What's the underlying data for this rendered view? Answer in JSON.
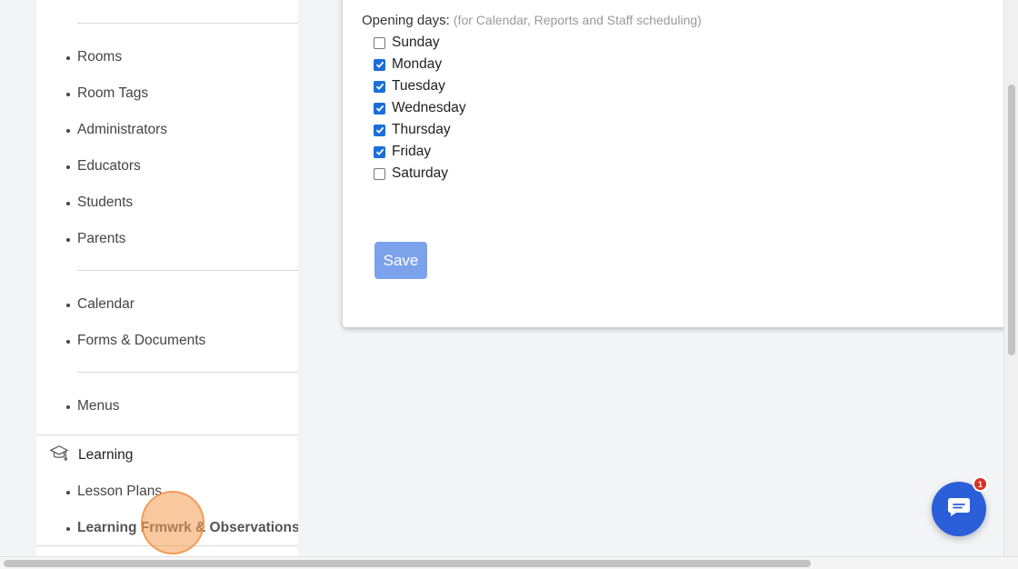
{
  "sidebar": {
    "group1": [
      "Rooms",
      "Room Tags",
      "Administrators",
      "Educators",
      "Students",
      "Parents"
    ],
    "group2": [
      "Calendar",
      "Forms & Documents"
    ],
    "group3": [
      "Menus"
    ],
    "learning": {
      "title": "Learning",
      "icon": "graduation-cap-icon",
      "items": [
        "Lesson Plans",
        "Learning Frmwrk & Observations"
      ]
    }
  },
  "settings": {
    "opening_days_label": "Opening days:",
    "opening_days_hint": "(for Calendar, Reports and Staff scheduling)",
    "days": [
      {
        "label": "Sunday",
        "checked": false
      },
      {
        "label": "Monday",
        "checked": true
      },
      {
        "label": "Tuesday",
        "checked": true
      },
      {
        "label": "Wednesday",
        "checked": true
      },
      {
        "label": "Thursday",
        "checked": true
      },
      {
        "label": "Friday",
        "checked": true
      },
      {
        "label": "Saturday",
        "checked": false
      }
    ],
    "save_label": "Save"
  },
  "chat": {
    "badge_count": "1",
    "icon": "chat-icon"
  },
  "colors": {
    "accent": "#2b5fd9",
    "save_button": "#7da2ec",
    "checkbox": "#1a6ed8",
    "badge": "#d93025"
  }
}
